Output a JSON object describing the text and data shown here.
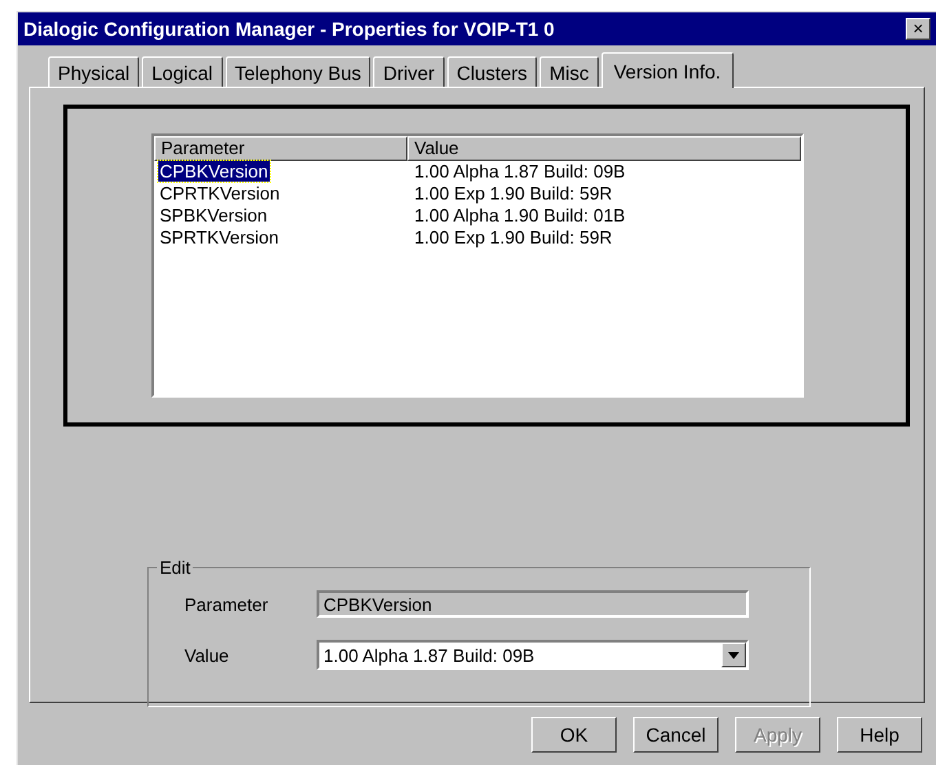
{
  "window": {
    "title": "Dialogic Configuration Manager - Properties for VOIP-T1 0",
    "close": "×"
  },
  "tabs": [
    {
      "label": "Physical",
      "selected": false
    },
    {
      "label": "Logical",
      "selected": false
    },
    {
      "label": "Telephony Bus",
      "selected": false
    },
    {
      "label": "Driver",
      "selected": false
    },
    {
      "label": "Clusters",
      "selected": false
    },
    {
      "label": "Misc",
      "selected": false
    },
    {
      "label": "Version Info.",
      "selected": true
    }
  ],
  "table": {
    "columns": [
      "Parameter",
      "Value"
    ],
    "rows": [
      {
        "parameter": "CPBKVersion",
        "value": "1.00 Alpha 1.87 Build: 09B",
        "selected": true
      },
      {
        "parameter": "CPRTKVersion",
        "value": "1.00 Exp 1.90 Build: 59R",
        "selected": false
      },
      {
        "parameter": "SPBKVersion",
        "value": "1.00 Alpha 1.90 Build: 01B",
        "selected": false
      },
      {
        "parameter": "SPRTKVersion",
        "value": "1.00 Exp 1.90 Build: 59R",
        "selected": false
      }
    ]
  },
  "edit": {
    "title": "Edit",
    "parameter_label": "Parameter",
    "parameter_value": "CPBKVersion",
    "value_label": "Value",
    "value": "1.00 Alpha 1.87 Build: 09B"
  },
  "buttons": [
    {
      "label": "OK",
      "disabled": false
    },
    {
      "label": "Cancel",
      "disabled": false
    },
    {
      "label": "Apply",
      "disabled": true
    },
    {
      "label": "Help",
      "disabled": false
    }
  ]
}
